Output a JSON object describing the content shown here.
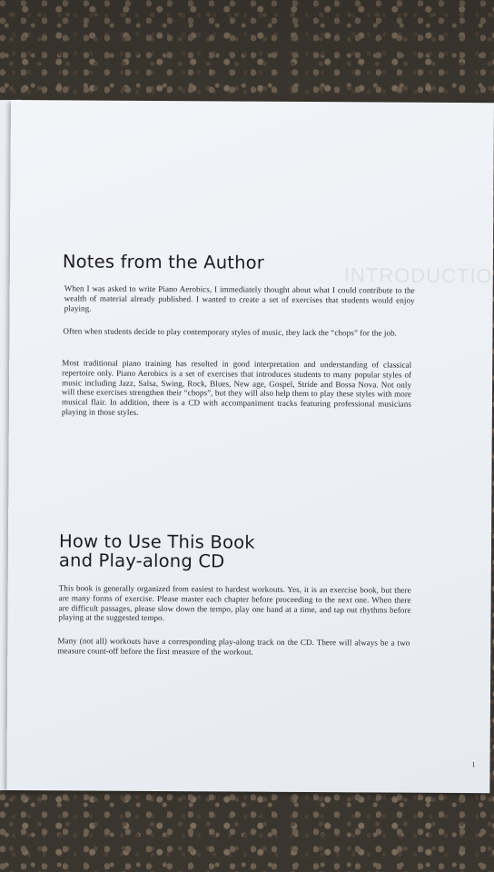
{
  "page": {
    "section1": {
      "title": "Notes from the Author",
      "paragraphs": [
        "When I was asked to write Piano Aerobics, I immediately thought about what I could contribute to the wealth of material already published. I wanted to create a set of exercises that students would enjoy playing.",
        "Often when students decide to play contemporary styles of music, they lack the “chops” for the job.",
        "Most traditional piano training has resulted in good interpretation and understanding of classical repertoire only. Piano Aerobics is a set of exercises that introduces students to many popular styles of music including Jazz, Salsa, Swing, Rock, Blues, New age, Gospel, Stride and Bossa Nova. Not only will these exercises strengthen their “chops”, but they will also help them to play these styles with more musical flair. In addition, there is a CD with accompaniment tracks featuring professional musicians playing in those styles."
      ]
    },
    "section2": {
      "title_line1": "How to Use This Book",
      "title_line2": "and Play-along CD",
      "paragraphs": [
        "This book is generally organized from easiest to hardest workouts. Yes, it is an exercise book, but there are many forms of exercise. Please master each chapter before proceeding to the next one. When there are difficult passages, please slow down the tempo, play one hand at a time, and tap out rhythms before playing at the suggested tempo.",
        "Many (not all) workouts have a corresponding play-along track on the CD. There will always be a two measure count-off before the first measure of the workout."
      ]
    },
    "page_number": "1"
  }
}
